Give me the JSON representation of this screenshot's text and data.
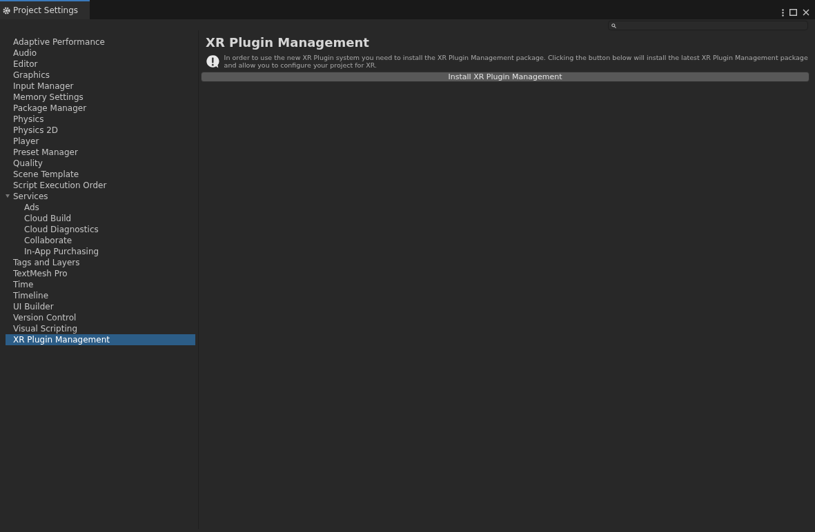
{
  "window": {
    "title": "Project Settings"
  },
  "sidebar": {
    "items": [
      {
        "label": "Adaptive Performance",
        "selected": false
      },
      {
        "label": "Audio",
        "selected": false
      },
      {
        "label": "Editor",
        "selected": false
      },
      {
        "label": "Graphics",
        "selected": false
      },
      {
        "label": "Input Manager",
        "selected": false
      },
      {
        "label": "Memory Settings",
        "selected": false
      },
      {
        "label": "Package Manager",
        "selected": false
      },
      {
        "label": "Physics",
        "selected": false
      },
      {
        "label": "Physics 2D",
        "selected": false
      },
      {
        "label": "Player",
        "selected": false
      },
      {
        "label": "Preset Manager",
        "selected": false
      },
      {
        "label": "Quality",
        "selected": false
      },
      {
        "label": "Scene Template",
        "selected": false
      },
      {
        "label": "Script Execution Order",
        "selected": false
      },
      {
        "label": "Services",
        "selected": false,
        "expanded": true,
        "children": [
          {
            "label": "Ads",
            "selected": false
          },
          {
            "label": "Cloud Build",
            "selected": false
          },
          {
            "label": "Cloud Diagnostics",
            "selected": false
          },
          {
            "label": "Collaborate",
            "selected": false
          },
          {
            "label": "In-App Purchasing",
            "selected": false
          }
        ]
      },
      {
        "label": "Tags and Layers",
        "selected": false
      },
      {
        "label": "TextMesh Pro",
        "selected": false
      },
      {
        "label": "Time",
        "selected": false
      },
      {
        "label": "Timeline",
        "selected": false
      },
      {
        "label": "UI Builder",
        "selected": false
      },
      {
        "label": "Version Control",
        "selected": false
      },
      {
        "label": "Visual Scripting",
        "selected": false
      },
      {
        "label": "XR Plugin Management",
        "selected": true
      }
    ]
  },
  "content": {
    "heading": "XR Plugin Management",
    "message": "In order to use the new XR Plugin system you need to install the XR Plugin Management package. Clicking the button below will install the latest XR Plugin Management package and allow you to configure your project for XR.",
    "button": "Install XR Plugin Management"
  }
}
